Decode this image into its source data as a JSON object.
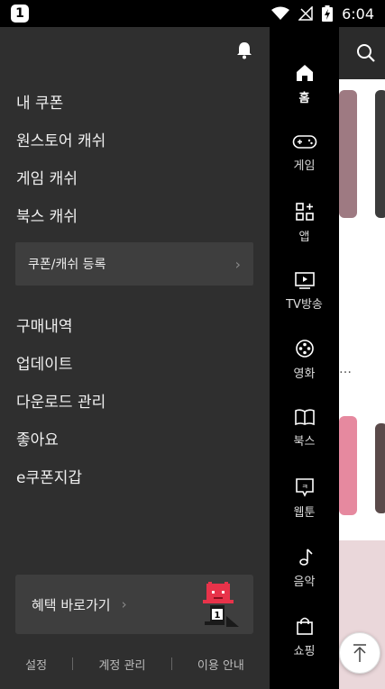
{
  "status_bar": {
    "app_badge": "1",
    "time": "6:04"
  },
  "drawer": {
    "menu_primary": [
      "내 쿠폰",
      "원스토어 캐쉬",
      "게임 캐쉬",
      "북스 캐쉬"
    ],
    "register_button": "쿠폰/캐쉬 등록",
    "menu_secondary": [
      "구매내역",
      "업데이트",
      "다운로드 관리",
      "좋아요",
      "e쿠폰지갑"
    ],
    "benefit_button": "혜택 바로가기",
    "mascot_badge": "1",
    "footer": [
      "설정",
      "계정 관리",
      "이용 안내"
    ]
  },
  "side_nav": [
    {
      "label": "홈",
      "icon": "home-icon",
      "active": true
    },
    {
      "label": "게임",
      "icon": "gamepad-icon"
    },
    {
      "label": "앱",
      "icon": "apps-icon"
    },
    {
      "label": "TV방송",
      "icon": "tv-icon"
    },
    {
      "label": "영화",
      "icon": "film-reel-icon"
    },
    {
      "label": "북스",
      "icon": "book-icon"
    },
    {
      "label": "웹툰",
      "icon": "webtoon-icon"
    },
    {
      "label": "음악",
      "icon": "music-note-icon"
    },
    {
      "label": "쇼핑",
      "icon": "shopping-bag-icon"
    }
  ],
  "background": {
    "ellipsis": "…"
  },
  "colors": {
    "drawer_bg": "#2f2f2f",
    "nav_bg": "#000000",
    "button_bg": "#3e3e3e",
    "mascot_red": "#e8334a"
  }
}
